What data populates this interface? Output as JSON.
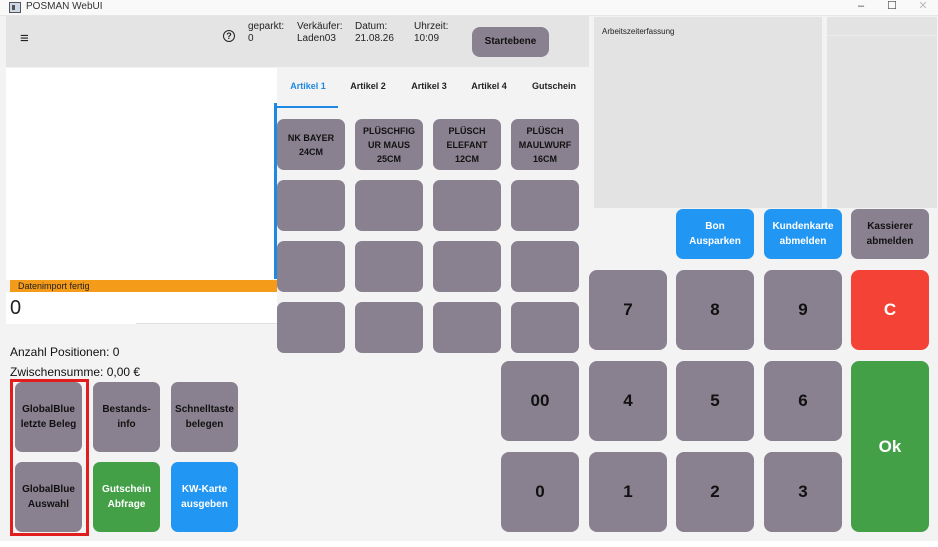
{
  "window": {
    "title": "POSMAN WebUI",
    "controls": {
      "minimize": "–",
      "maximize": "☐",
      "close": "✕"
    }
  },
  "header": {
    "menu_icon": "≡",
    "help_icon": "?",
    "geparkt": {
      "label": "geparkt:",
      "value": "0"
    },
    "verkaeufer": {
      "label": "Verkäufer:",
      "value": "Laden03"
    },
    "datum": {
      "label": "Datum:",
      "value": "21.08.26"
    },
    "uhrzeit": {
      "label": "Uhrzeit:",
      "value": "10:09"
    },
    "start_button": "Startebene"
  },
  "arbeitszeit": {
    "title": "Arbeitszeiterfassung"
  },
  "receipt": {
    "status": "Datenimport fertig",
    "amount": "0",
    "positions": "Anzahl Positionen: 0",
    "subtotal": "Zwischensumme: 0,00 €"
  },
  "tabs": [
    {
      "label": "Artikel 1",
      "active": true
    },
    {
      "label": "Artikel 2",
      "active": false
    },
    {
      "label": "Artikel 3",
      "active": false
    },
    {
      "label": "Artikel 4",
      "active": false
    },
    {
      "label": "Gutschein",
      "active": false
    }
  ],
  "articles": [
    {
      "label": "NK BAYER\n24CM"
    },
    {
      "label": "PLÜSCHFIG\nUR MAUS\n25CM"
    },
    {
      "label": "PLÜSCH\nELEFANT\n12CM"
    },
    {
      "label": "PLÜSCH\nMAULWURF\n16CM"
    }
  ],
  "functions": {
    "globalblue_last": "GlobalBlue\nletzte Beleg",
    "bestandsinfo": "Bestands-\ninfo",
    "schnelltaste": "Schnelltaste\nbelegen",
    "globalblue_select": "GlobalBlue\nAuswahl",
    "gutschein": "Gutschein\nAbfrage",
    "kwkarte": "KW-Karte\nausgeben"
  },
  "actions": {
    "bon_parken": "Bon\nAusparken",
    "kundenkarte": "Kundenkarte\nabmelden",
    "kassierer": "Kassierer\nabmelden"
  },
  "numpad": {
    "k7": "7",
    "k8": "8",
    "k9": "9",
    "clear": "C",
    "k00": "00",
    "k4": "4",
    "k5": "5",
    "k6": "6",
    "k0": "0",
    "k1": "1",
    "k2": "2",
    "k3": "3",
    "ok": "Ok"
  },
  "colors": {
    "button_grey": "#8a8190",
    "accent_blue": "#2196f3",
    "ok_green": "#43a047",
    "clear_red": "#f44336",
    "status_orange": "#f59b1a",
    "highlight_red": "#e11d1d"
  }
}
